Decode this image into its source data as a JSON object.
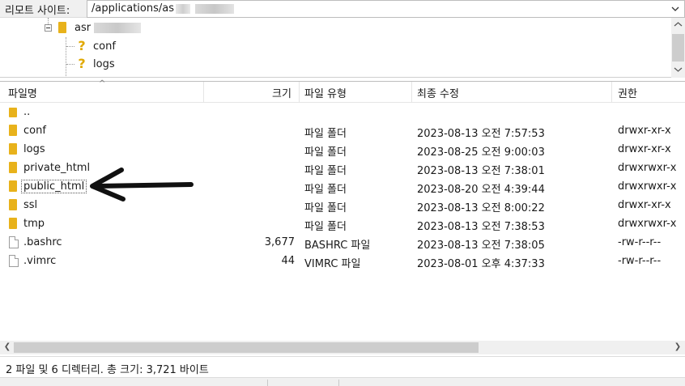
{
  "site_bar": {
    "label": "리모트 사이트:",
    "path": "/applications/as"
  },
  "tree": {
    "root_name": "asr",
    "children": [
      {
        "name": "conf"
      },
      {
        "name": "logs"
      }
    ]
  },
  "list": {
    "columns": [
      "파일명",
      "크기",
      "파일 유형",
      "최종 수정",
      "권한"
    ],
    "rows": [
      {
        "name": "..",
        "size": "",
        "type": "",
        "modified": "",
        "perms": "",
        "icon": "folder-up"
      },
      {
        "name": "conf",
        "size": "",
        "type": "파일 폴더",
        "modified": "2023-08-13 오전 7:57:53",
        "perms": "drwxr-xr-x",
        "icon": "folder"
      },
      {
        "name": "logs",
        "size": "",
        "type": "파일 폴더",
        "modified": "2023-08-25 오전 9:00:03",
        "perms": "drwxr-xr-x",
        "icon": "folder"
      },
      {
        "name": "private_html",
        "size": "",
        "type": "파일 폴더",
        "modified": "2023-08-13 오전 7:38:01",
        "perms": "drwxrwxr-x",
        "icon": "folder"
      },
      {
        "name": "public_html",
        "size": "",
        "type": "파일 폴더",
        "modified": "2023-08-20 오전 4:39:44",
        "perms": "drwxrwxr-x",
        "icon": "folder"
      },
      {
        "name": "ssl",
        "size": "",
        "type": "파일 폴더",
        "modified": "2023-08-13 오전 8:00:22",
        "perms": "drwxr-xr-x",
        "icon": "folder"
      },
      {
        "name": "tmp",
        "size": "",
        "type": "파일 폴더",
        "modified": "2023-08-13 오전 7:38:53",
        "perms": "drwxrwxr-x",
        "icon": "folder"
      },
      {
        "name": ".bashrc",
        "size": "3,677",
        "type": "BASHRC 파일",
        "modified": "2023-08-13 오전 7:38:05",
        "perms": "-rw-r--r--",
        "icon": "file"
      },
      {
        "name": ".vimrc",
        "size": "44",
        "type": "VIMRC 파일",
        "modified": "2023-08-01 오후 4:37:33",
        "perms": "-rw-r--r--",
        "icon": "file"
      }
    ]
  },
  "status": {
    "text": "2 파일 및 6 디렉터리. 총 크기: 3,721 바이트"
  },
  "colors": {
    "folder": "#e8b21b",
    "question_icon": "#e0a800",
    "arrow": "#111111"
  }
}
